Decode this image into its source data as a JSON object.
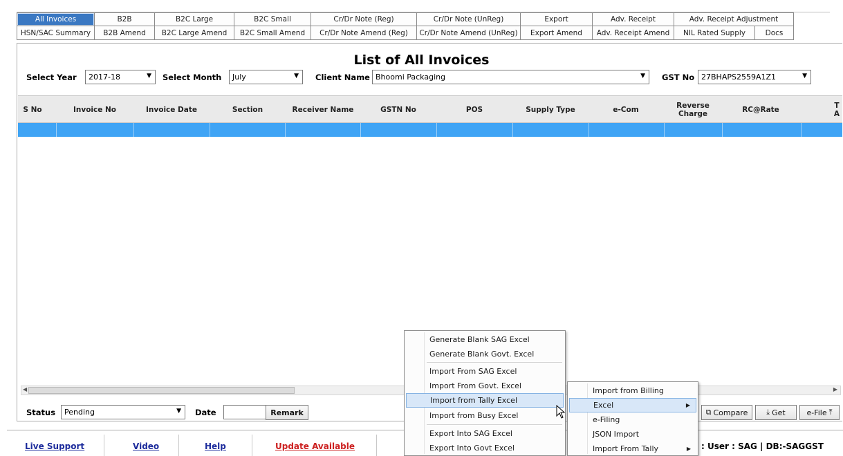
{
  "tabs": {
    "row1": [
      "All Invoices",
      "B2B",
      "B2C Large",
      "B2C Small",
      "Cr/Dr Note (Reg)",
      "Cr/Dr Note (UnReg)",
      "Export",
      "Adv. Receipt",
      "Adv. Receipt Adjustment"
    ],
    "row2": [
      "HSN/SAC Summary",
      "B2B Amend",
      "B2C Large Amend",
      "B2C Small Amend",
      "Cr/Dr Note Amend (Reg)",
      "Cr/Dr Note Amend (UnReg)",
      "Export Amend",
      "Adv. Receipt Amend",
      "NIL Rated Supply",
      "Docs"
    ],
    "active": "All Invoices"
  },
  "page_title": "List of All Invoices",
  "filters": {
    "year_label": "Select Year",
    "year_value": "2017-18",
    "month_label": "Select Month",
    "month_value": "July",
    "client_label": "Client Name",
    "client_value": "Bhoomi Packaging",
    "gst_label": "GST No",
    "gst_value": "27BHAPS2559A1Z1"
  },
  "grid": {
    "columns": [
      "S No",
      "Invoice No",
      "Invoice Date",
      "Section",
      "Receiver Name",
      "GSTN No",
      "POS",
      "Supply Type",
      "e-Com",
      "Reverse Charge",
      "RC@Rate",
      "T A"
    ]
  },
  "status_row": {
    "status_label": "Status",
    "status_value": "Pending",
    "date_label": "Date",
    "date_value": "",
    "remark_button": "Remark"
  },
  "action_buttons": {
    "compare": "Compare",
    "get": "Get",
    "efile": "e-File"
  },
  "footer": {
    "live_support": "Live Support",
    "video": "Video",
    "help": "Help",
    "update": "Update Available",
    "status": ": User : SAG | DB:-SAGGST"
  },
  "context_menu": {
    "items": [
      "Generate Blank SAG Excel",
      "Generate Blank Govt. Excel",
      "Import From SAG Excel",
      "Import From Govt. Excel",
      "Import from Tally Excel",
      "Import from Busy Excel",
      "Export Into SAG Excel",
      "Export Into Govt Excel"
    ],
    "highlighted": "Import from Tally Excel"
  },
  "parent_menu": {
    "items": [
      "Import from Billing",
      "Excel",
      "e-Filing",
      "JSON Import",
      "Import From Tally"
    ],
    "highlighted": "Excel"
  },
  "colors": {
    "accent": "#3a78c2",
    "selection": "#3fa4f5",
    "link": "#1d2c9c",
    "update_link": "#cc2020"
  }
}
